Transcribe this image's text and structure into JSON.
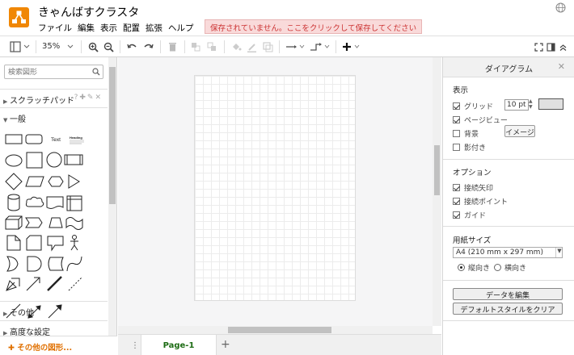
{
  "app": {
    "title": "きゃんばすクラスタ",
    "save_warning": "保存されていません。ここをクリックして保存してください"
  },
  "menu": [
    "ファイル",
    "編集",
    "表示",
    "配置",
    "拡張",
    "ヘルプ"
  ],
  "toolbar": {
    "zoom": "35%"
  },
  "sidebar": {
    "search_placeholder": "検索図形",
    "scratchpad": "スクラッチパッド",
    "scratchpad_tools": "?✚✎✕",
    "general": "一般",
    "other": "その他",
    "advanced": "高度な設定",
    "more_shapes": "その他の図形..."
  },
  "shapes_labels": {
    "text": "Text",
    "heading": "Heading"
  },
  "pages": {
    "current": "Page-1"
  },
  "panel": {
    "title": "ダイアグラム",
    "view_header": "表示",
    "grid": "グリッド",
    "grid_size": "10 pt",
    "page_view": "ページビュー",
    "background": "背景",
    "image_button": "イメージ",
    "shadow": "影付き",
    "options_header": "オプション",
    "connection_arrows": "接続矢印",
    "connection_points": "接続ポイント",
    "guides": "ガイド",
    "paper_header": "用紙サイズ",
    "paper_size": "A4 (210 mm x 297 mm)",
    "portrait": "縦向き",
    "landscape": "横向き",
    "edit_data": "データを編集",
    "clear_default_style": "デフォルトスタイルをクリア",
    "checks": {
      "grid": true,
      "page_view": true,
      "background": false,
      "shadow": false,
      "connection_arrows": true,
      "connection_points": true,
      "guides": true
    },
    "orientation": "portrait"
  },
  "colors": {
    "logo": "#f08705",
    "accent_orange": "#e07000",
    "page_tab_green": "#1c6b13",
    "warning_bg": "#f9dada",
    "warning_text": "#cc3333"
  }
}
